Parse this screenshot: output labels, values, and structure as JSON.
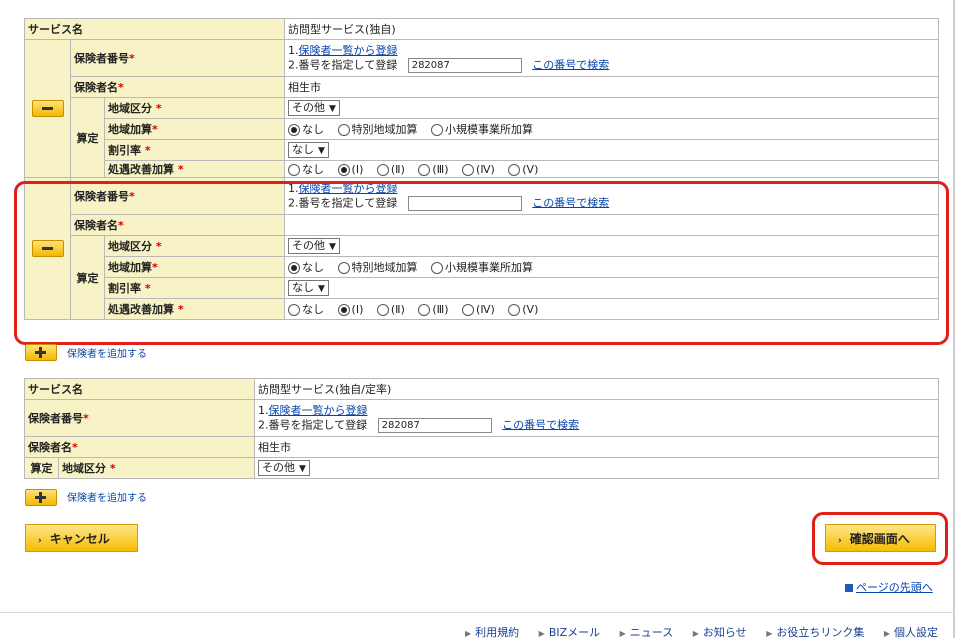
{
  "sections": {
    "service_label": "サービス名",
    "service1_value": "訪問型サービス(独自)",
    "service2_value": "訪問型サービス(独自/定率)",
    "insurer_no_label": "保険者番号",
    "insurer_name_label": "保険者名",
    "calc_label": "算定",
    "area_label": "地域区分",
    "area_add_label": "地域加算",
    "discount_label": "割引率",
    "treatment_label": "処遇改善加算"
  },
  "common": {
    "register_from_list_prefix": "1.",
    "register_from_list_link": "保険者一覧から登録",
    "register_by_number": "2.番号を指定して登録",
    "search_by_number_link": "この番号で検索",
    "area_select": "その他",
    "discount_select": "なし",
    "area_add_options": [
      "なし",
      "特別地域加算",
      "小規模事業所加算"
    ],
    "treatment_options": [
      "なし",
      "(Ⅰ)",
      "(Ⅱ)",
      "(Ⅲ)",
      "(Ⅳ)",
      "(Ⅴ)"
    ],
    "add_insurer_link": "保険者を追加する"
  },
  "block1": {
    "insurer_number": "282087",
    "insurer_name": "相生市"
  },
  "block2": {
    "insurer_number": "",
    "insurer_name": ""
  },
  "block3": {
    "insurer_number": "282087",
    "insurer_name": "相生市"
  },
  "buttons": {
    "cancel": "キャンセル",
    "confirm": "確認画面へ"
  },
  "page_top_link": "ページの先頭へ",
  "footer": [
    "利用規約",
    "BIZメール",
    "ニュース",
    "お知らせ",
    "お役立ちリンク集",
    "個人設定"
  ],
  "colors": {
    "label_bg": "#f7f3c6",
    "button": "#f5bd00",
    "highlight": "#e0201b",
    "link": "#0645ad"
  }
}
